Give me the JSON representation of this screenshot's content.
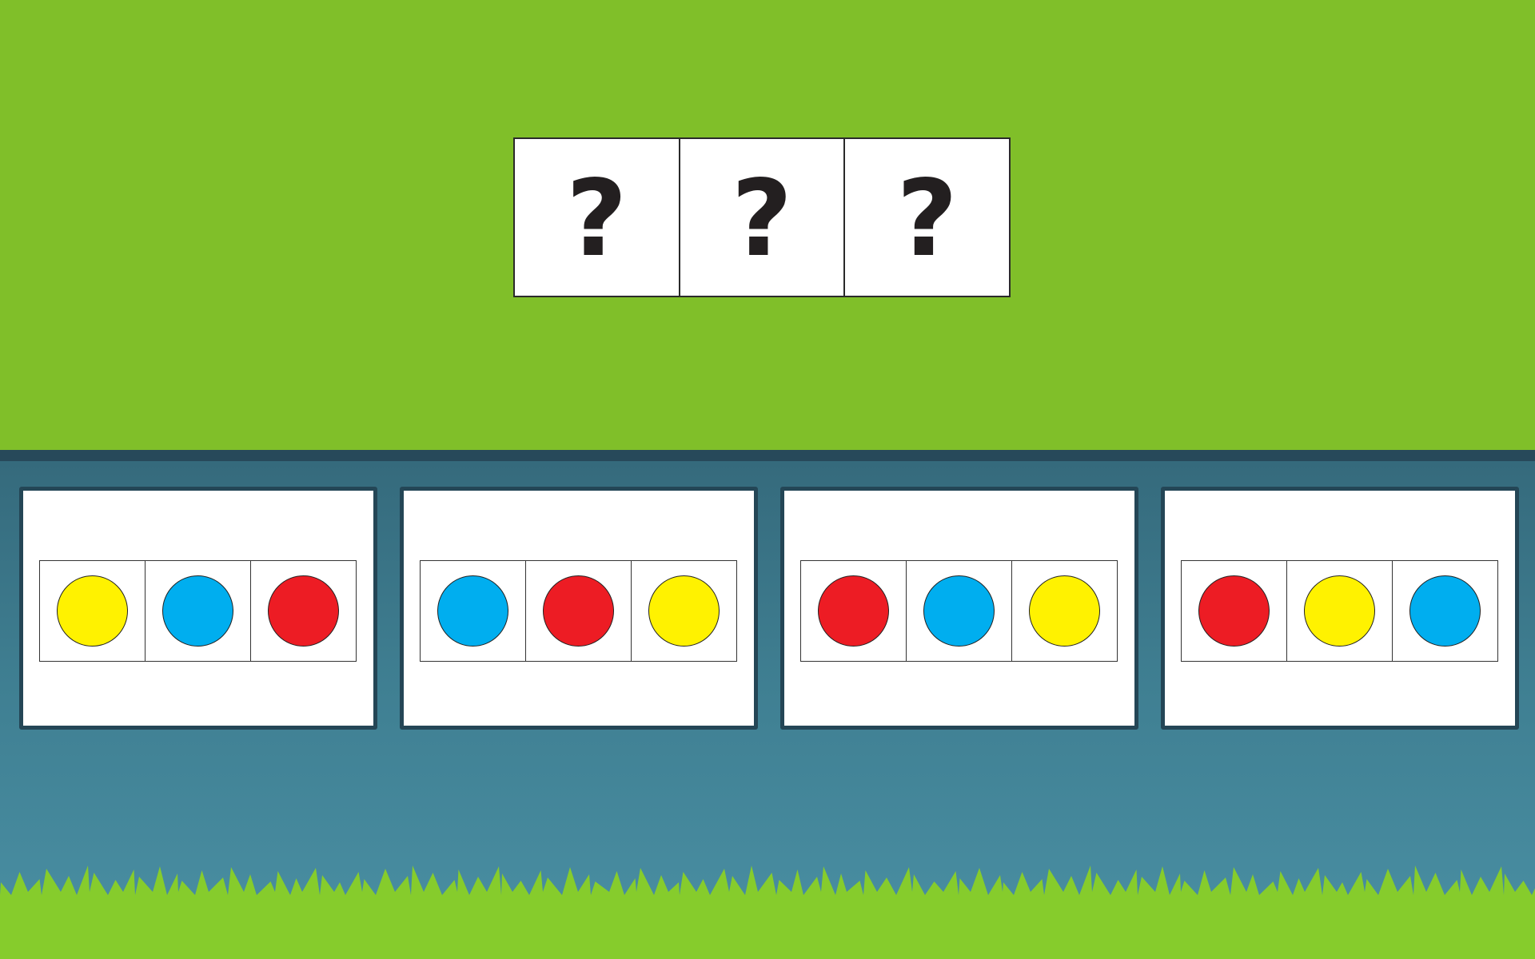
{
  "colors": {
    "sky": "#80bf29",
    "divider": "#27495a",
    "panel_top": "#356a7c",
    "panel_bottom": "#4a90a4",
    "grass": "#86cc2c",
    "yellow": "#fff200",
    "blue": "#00aeef",
    "red": "#ed1c24"
  },
  "question": {
    "cells": [
      "?",
      "?",
      "?"
    ]
  },
  "options": [
    {
      "circles": [
        "yellow",
        "blue",
        "red"
      ]
    },
    {
      "circles": [
        "blue",
        "red",
        "yellow"
      ]
    },
    {
      "circles": [
        "red",
        "blue",
        "yellow"
      ]
    },
    {
      "circles": [
        "red",
        "yellow",
        "blue"
      ]
    }
  ]
}
